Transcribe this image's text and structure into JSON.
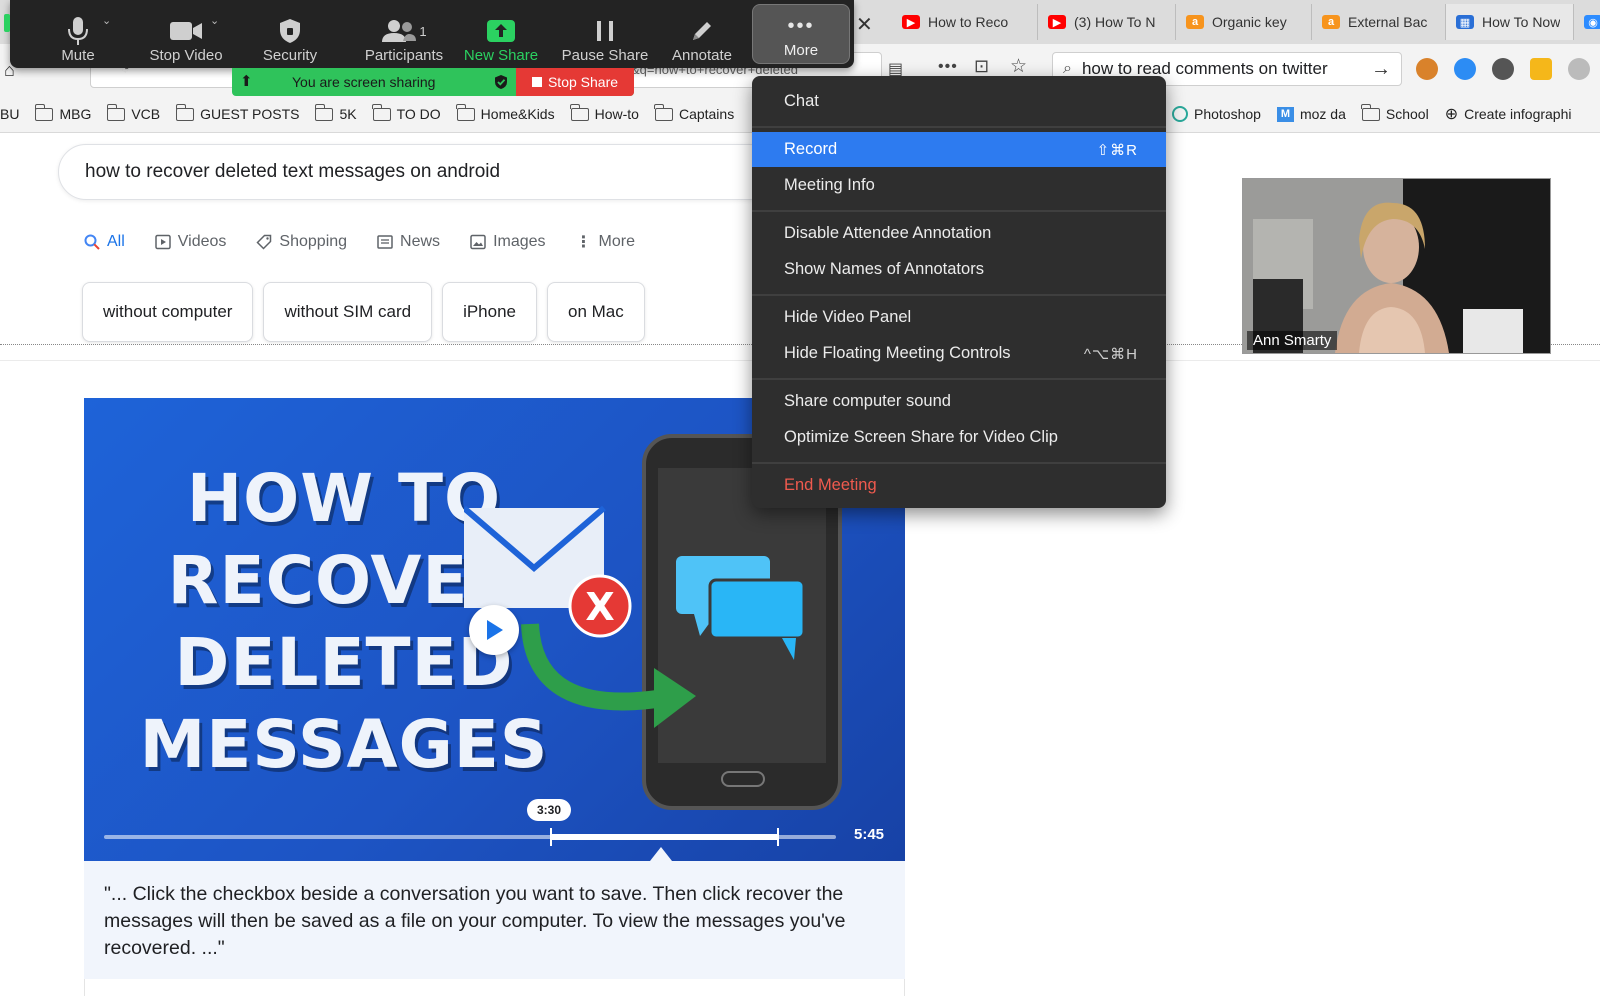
{
  "browser": {
    "tabs": [
      {
        "label": "How to Reco",
        "icon": "youtube-icon"
      },
      {
        "label": "(3) How To N",
        "icon": "youtube-icon"
      },
      {
        "label": "Organic key",
        "icon": "ahrefs-icon"
      },
      {
        "label": "External Bac",
        "icon": "ahrefs-icon"
      },
      {
        "label": "How To Now",
        "icon": "site-icon"
      }
    ],
    "url_fragment": "&q=how+to+recover+deleted",
    "search_text": "how to read comments on twitter",
    "bookmarks_left": [
      "BU",
      "MBG",
      "VCB",
      "GUEST POSTS",
      "5K",
      "TO DO",
      "Home&Kids",
      "How-to",
      "Captains"
    ],
    "bookmarks_right": [
      "Photoshop",
      "moz da",
      "School",
      "Create infographi"
    ]
  },
  "zoom": {
    "buttons": [
      {
        "label": "Mute",
        "icon": "microphone-icon"
      },
      {
        "label": "Stop Video",
        "icon": "video-camera-icon"
      },
      {
        "label": "Security",
        "icon": "shield-icon"
      },
      {
        "label": "Participants",
        "icon": "participants-icon",
        "count": "1"
      },
      {
        "label": "New Share",
        "icon": "share-screen-icon"
      },
      {
        "label": "Pause Share",
        "icon": "pause-icon"
      },
      {
        "label": "Annotate",
        "icon": "pencil-icon"
      },
      {
        "label": "More",
        "icon": "ellipsis-icon"
      }
    ],
    "sharing_status": "You are screen sharing",
    "stop_share": "Stop Share",
    "colors": {
      "accent_green": "#2bd161",
      "stop_red": "#e53935",
      "highlight_blue": "#2d7bf0",
      "danger_text": "#ef5a4e"
    }
  },
  "menu": {
    "items": [
      {
        "label": "Chat",
        "shortcut": ""
      },
      {
        "label": "Record",
        "shortcut": "⇧⌘R"
      },
      {
        "label": "Meeting Info",
        "shortcut": ""
      },
      {
        "label": "Disable Attendee Annotation",
        "shortcut": ""
      },
      {
        "label": "Show Names of Annotators",
        "shortcut": ""
      },
      {
        "label": "Hide Video Panel",
        "shortcut": ""
      },
      {
        "label": "Hide Floating Meeting Controls",
        "shortcut": "^⌥⌘H"
      },
      {
        "label": "Share computer sound",
        "shortcut": ""
      },
      {
        "label": "Optimize Screen Share for Video Clip",
        "shortcut": ""
      },
      {
        "label": "End Meeting",
        "shortcut": ""
      }
    ]
  },
  "google": {
    "query": "how to recover deleted text messages on android",
    "tabs": [
      "All",
      "Videos",
      "Shopping",
      "News",
      "Images",
      "More"
    ],
    "chips": [
      "without computer",
      "without SIM card",
      "iPhone",
      "on Mac"
    ],
    "video": {
      "title_lines": [
        "HOW TO",
        "RECOVER",
        "DELETED",
        "MESSAGES"
      ],
      "current_time": "3:30",
      "duration": "5:45"
    },
    "snippet": "\"... Click the checkbox beside a conversation you want to save. Then click recover the messages will then be saved as a file on your computer. To view the messages you've recovered. ...\""
  },
  "webcam": {
    "name": "Ann Smarty"
  }
}
